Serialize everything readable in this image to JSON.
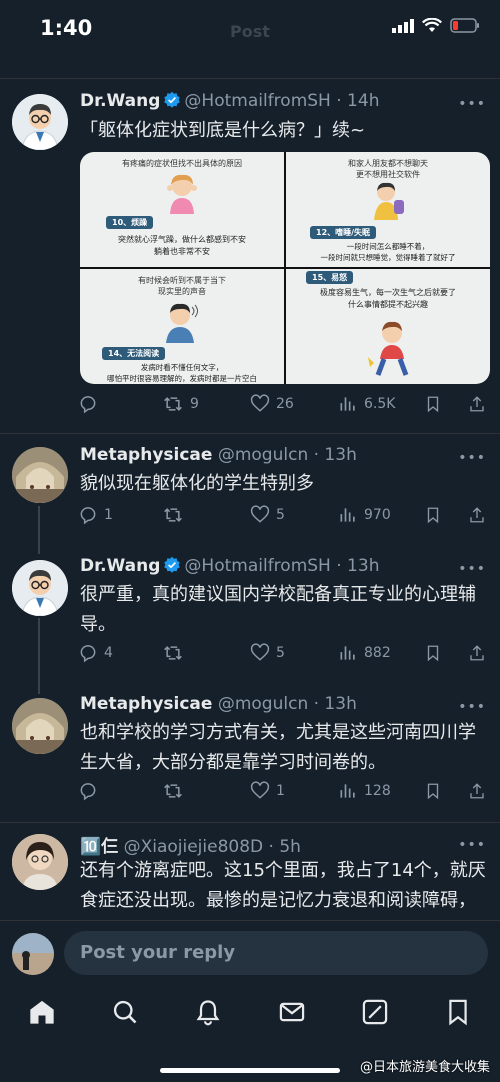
{
  "status": {
    "time": "1:40",
    "header_title": "Post"
  },
  "tweets": [
    {
      "name": "Dr.Wang",
      "handle": "@HotmailfromSH",
      "time": "· 14h",
      "text": "「躯体化症状到底是什么病？」续~",
      "media": {
        "panel1": {
          "caption": "有疼痛的症状但找不出具体的原因",
          "badge": "10、烦躁",
          "body": "突然就心浮气躁，做什么都感到不安\n躺着也非常不安"
        },
        "panel2": {
          "caption": "和家人朋友都不想聊天\n更不想用社交软件",
          "badge": "12、嗜睡/失眠",
          "body": "一段时间怎么都睡不着，\n一段时间就只想睡觉，觉得睡着了就好了"
        },
        "panel3": {
          "caption": "有时候会听到不属于当下\n现实里的声音",
          "badge": "14、无法阅读",
          "body": "发病时看不懂任何文字，\n哪怕平时很容易理解的，发病时都是一片空白"
        },
        "panel4": {
          "caption": "15、易怒",
          "body": "极度容易生气，每一次生气之后就要了\n什么事情都提不起兴趣"
        }
      },
      "replies": "",
      "retweets": "9",
      "likes": "26",
      "views": "6.5K"
    },
    {
      "name": "Metaphysicae",
      "handle": "@mogulcn",
      "time": "· 13h",
      "text": "貌似现在躯体化的学生特别多",
      "replies": "1",
      "retweets": "",
      "likes": "5",
      "views": "970"
    },
    {
      "name": "Dr.Wang",
      "handle": "@HotmailfromSH",
      "time": "· 13h",
      "text": "很严重，真的建议国内学校配备真正专业的心理辅导。",
      "replies": "4",
      "retweets": "",
      "likes": "5",
      "views": "882"
    },
    {
      "name": "Metaphysicae",
      "handle": "@mogulcn",
      "time": "· 13h",
      "text": "也和学校的学习方式有关，尤其是这些河南四川学生大省，大部分都是靠学习时间卷的。",
      "replies": "",
      "retweets": "",
      "likes": "1",
      "views": "128"
    },
    {
      "name": "🔟仨",
      "handle": "@Xiaojiejie808D",
      "time": "· 5h",
      "text": "还有个游离症吧。这15个里面，我占了14个，就厌食症还没出现。最惨的是记忆力衰退和阅读障碍，认知障碍"
    }
  ],
  "reply_bar": {
    "placeholder": "Post your reply"
  },
  "tabs": [
    "home",
    "search",
    "notifications",
    "messages",
    "grok",
    "bookmarks"
  ],
  "watermark": "@日本旅游美食大收集",
  "colors": {
    "background": "#15202b",
    "accent": "#1d9bf0",
    "text": "#e7e9ea",
    "muted": "#8b98a5"
  }
}
